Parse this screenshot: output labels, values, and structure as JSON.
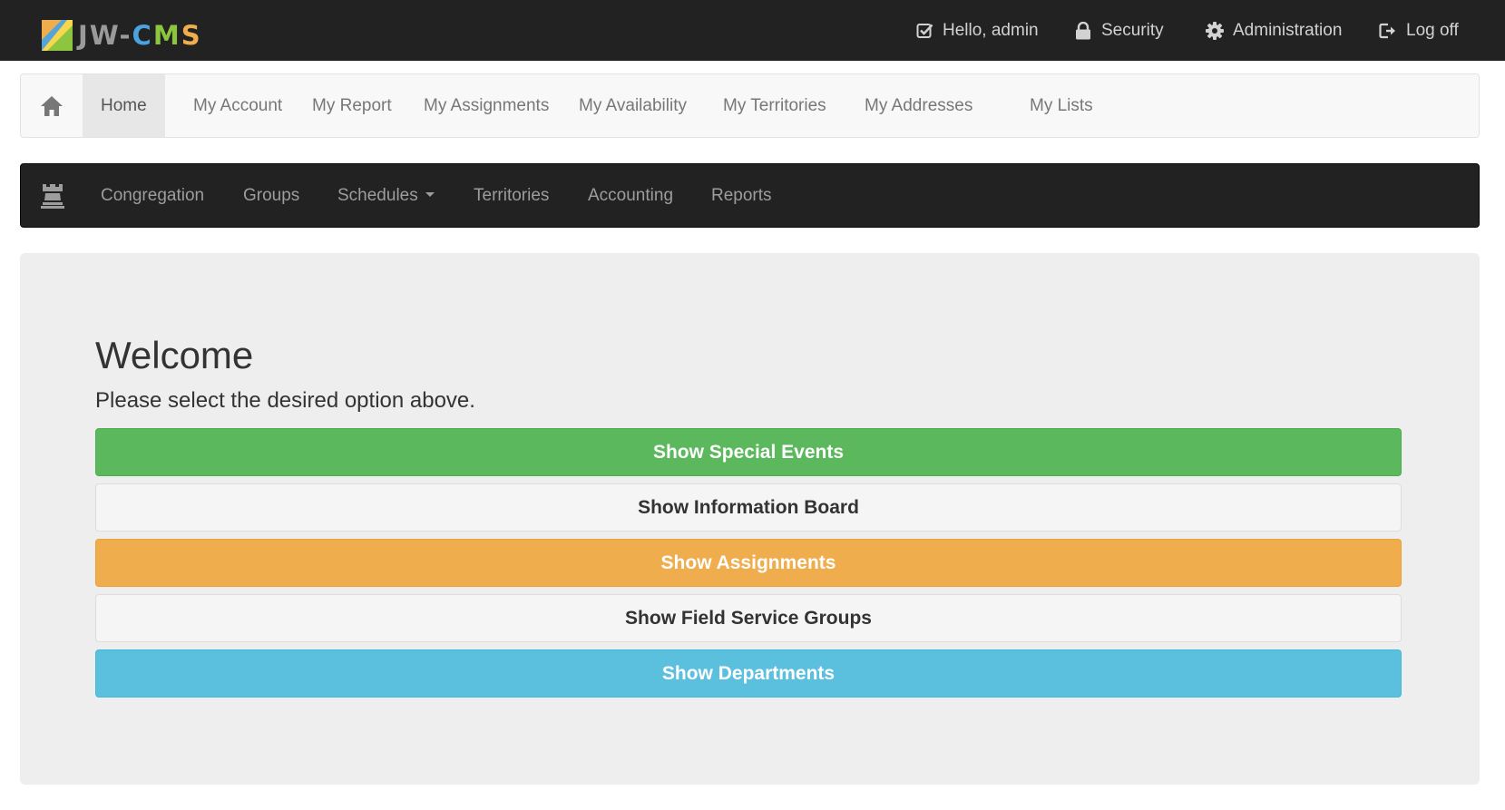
{
  "brand": {
    "jw": "JW",
    "dash": "-",
    "c": "C",
    "m": "M",
    "s": "S",
    "colors": {
      "blue": "#4aa3df",
      "green": "#8cc63f",
      "orange": "#f0ad4e",
      "gray": "#9a9a9a"
    }
  },
  "topnav": {
    "hello": "Hello, admin",
    "security": "Security",
    "administration": "Administration",
    "logoff": "Log off",
    "icons": [
      "check-square-icon",
      "lock-icon",
      "gear-icon",
      "logout-icon"
    ]
  },
  "user_nav": {
    "home_icon": "home-icon",
    "items": [
      "Home",
      "My Account",
      "My Report",
      "My Assignments",
      "My Availability",
      "My Territories",
      "My Addresses",
      "My Lists"
    ],
    "active": "Home"
  },
  "admin_nav": {
    "brand_icon": "tower-icon",
    "items": [
      "Congregation",
      "Groups",
      "Schedules",
      "Territories",
      "Accounting",
      "Reports"
    ]
  },
  "main": {
    "title": "Welcome",
    "subtitle": "Please select the desired option above.",
    "buttons": [
      {
        "label": "Show Special Events",
        "color": "#5cb85c"
      },
      {
        "label": "Show Information Board",
        "color": "#f5f5f5"
      },
      {
        "label": "Show Assignments",
        "color": "#f0ad4e"
      },
      {
        "label": "Show Field Service Groups",
        "color": "#f5f5f5"
      },
      {
        "label": "Show Departments",
        "color": "#5bc0de"
      }
    ]
  }
}
